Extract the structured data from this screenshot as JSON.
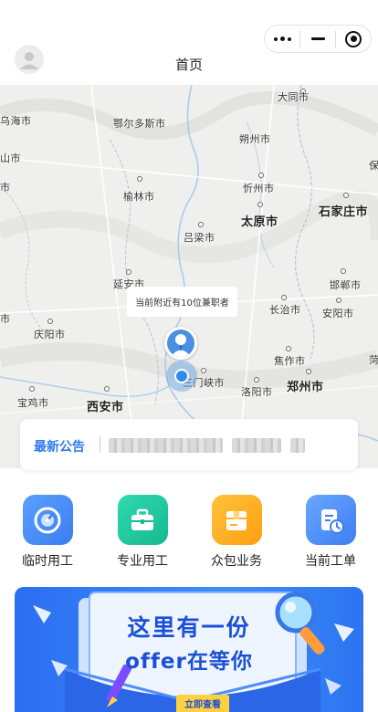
{
  "header": {
    "title": "首页",
    "avatar_icon": "user-icon",
    "capsule": {
      "more_icon": "more-dots-icon",
      "minimize_icon": "minus-icon",
      "close_icon": "target-circle-icon"
    }
  },
  "map": {
    "cities": [
      {
        "name": "大同市",
        "size": "small"
      },
      {
        "name": "乌海市",
        "size": "small"
      },
      {
        "name": "鄂尔多斯市",
        "size": "small"
      },
      {
        "name": "朔州市",
        "size": "small"
      },
      {
        "name": "山市",
        "size": "small"
      },
      {
        "name": "保",
        "size": "small"
      },
      {
        "name": "榆林市",
        "size": "small"
      },
      {
        "name": "市",
        "size": "small"
      },
      {
        "name": "忻州市",
        "size": "small"
      },
      {
        "name": "石家庄市",
        "size": "big"
      },
      {
        "name": "太原市",
        "size": "big"
      },
      {
        "name": "吕梁市",
        "size": "small"
      },
      {
        "name": "延安市",
        "size": "small"
      },
      {
        "name": "邯郸市",
        "size": "small"
      },
      {
        "name": "长治市",
        "size": "small"
      },
      {
        "name": "安阳市",
        "size": "small"
      },
      {
        "name": "庆阳市",
        "size": "small"
      },
      {
        "name": "焦作市",
        "size": "small"
      },
      {
        "name": "菏",
        "size": "small"
      },
      {
        "name": "三门峡市",
        "size": "small"
      },
      {
        "name": "洛阳市",
        "size": "small"
      },
      {
        "name": "郑州市",
        "size": "big"
      },
      {
        "name": "宝鸡市",
        "size": "small"
      },
      {
        "name": "西安市",
        "size": "big"
      },
      {
        "name": "市",
        "size": "small"
      }
    ],
    "tip": "当前附近有10位兼职者",
    "worker_icon": "worker-avatar-icon",
    "location_icon": "my-location-icon"
  },
  "notice": {
    "title": "最新公告"
  },
  "functions": [
    {
      "label": "临时用工",
      "icon": "speedometer-icon",
      "color": "#4d8ef7"
    },
    {
      "label": "专业用工",
      "icon": "briefcase-icon",
      "color": "#23c7a0"
    },
    {
      "label": "众包业务",
      "icon": "package-icon",
      "color": "#ffb31a"
    },
    {
      "label": "当前工单",
      "icon": "order-clock-icon",
      "color": "#4d8ef7"
    }
  ],
  "banner": {
    "line1": "这里有一份",
    "line2": "offer在等你",
    "cta": "立即查看",
    "magnifier_icon": "magnifier-icon",
    "pen_icon": "pen-icon"
  }
}
